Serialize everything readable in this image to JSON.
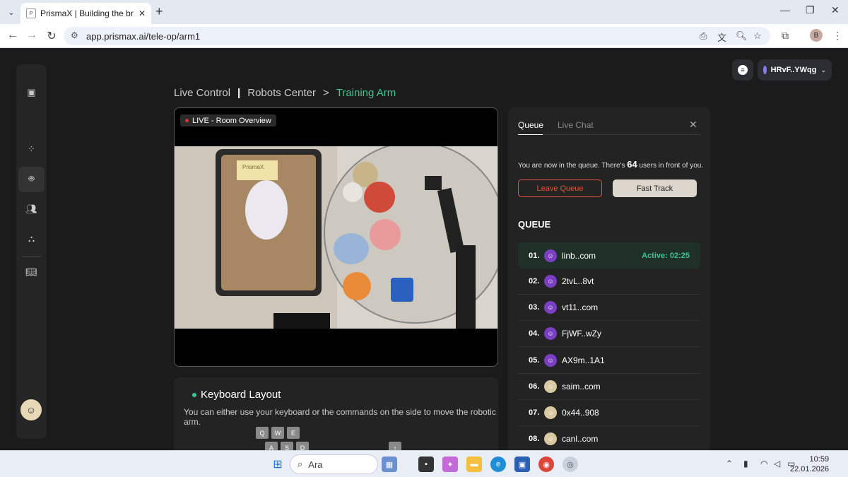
{
  "browser": {
    "tab_title": "PrismaX | Building the bridge be",
    "tab_favicon": "P",
    "url": "app.prismax.ai/tele-op/arm1",
    "profile_initial": "B"
  },
  "header": {
    "wallet_label": "HRvF..YWqg"
  },
  "breadcrumb": {
    "live_control": "Live Control",
    "separator": "|",
    "robots_center": "Robots Center",
    "arrow": ">",
    "training_arm": "Training Arm"
  },
  "video": {
    "live_label": "LIVE - Room Overview",
    "scene_label": "PrismaX"
  },
  "keyboard": {
    "title": "Keyboard Layout",
    "description": "You can either use your keyboard or the commands on the side to move the robotic arm.",
    "keys_row1": [
      "Q",
      "W",
      "E"
    ],
    "keys_row2": [
      "A",
      "S",
      "D"
    ],
    "arrow_key": "↑"
  },
  "queue": {
    "tab_queue": "Queue",
    "tab_chat": "Live Chat",
    "message_prefix": "You are now in the queue. There's ",
    "users_ahead": "64",
    "message_suffix": " users in front of you.",
    "leave_label": "Leave Queue",
    "fast_label": "Fast Track",
    "heading": "QUEUE",
    "rows": [
      {
        "num": "01.",
        "name": "linb..com",
        "status": "Active: 02:25",
        "avatar_color": "#7b3fc4"
      },
      {
        "num": "02.",
        "name": "2tvL..8vt",
        "status": "",
        "avatar_color": "#7b3fc4"
      },
      {
        "num": "03.",
        "name": "vt11..com",
        "status": "",
        "avatar_color": "#7b3fc4"
      },
      {
        "num": "04.",
        "name": "FjWF..wZy",
        "status": "",
        "avatar_color": "#7b3fc4"
      },
      {
        "num": "05.",
        "name": "AX9m..1A1",
        "status": "",
        "avatar_color": "#7b3fc4"
      },
      {
        "num": "06.",
        "name": "saim..com",
        "status": "",
        "avatar_color": "#d9c8a0"
      },
      {
        "num": "07.",
        "name": "0x44..908",
        "status": "",
        "avatar_color": "#d9c8a0"
      },
      {
        "num": "08.",
        "name": "canl..com",
        "status": "",
        "avatar_color": "#d9c8a0"
      }
    ]
  },
  "taskbar": {
    "search_placeholder": "Ara",
    "time": "10:59",
    "date": "22.01.2026"
  }
}
